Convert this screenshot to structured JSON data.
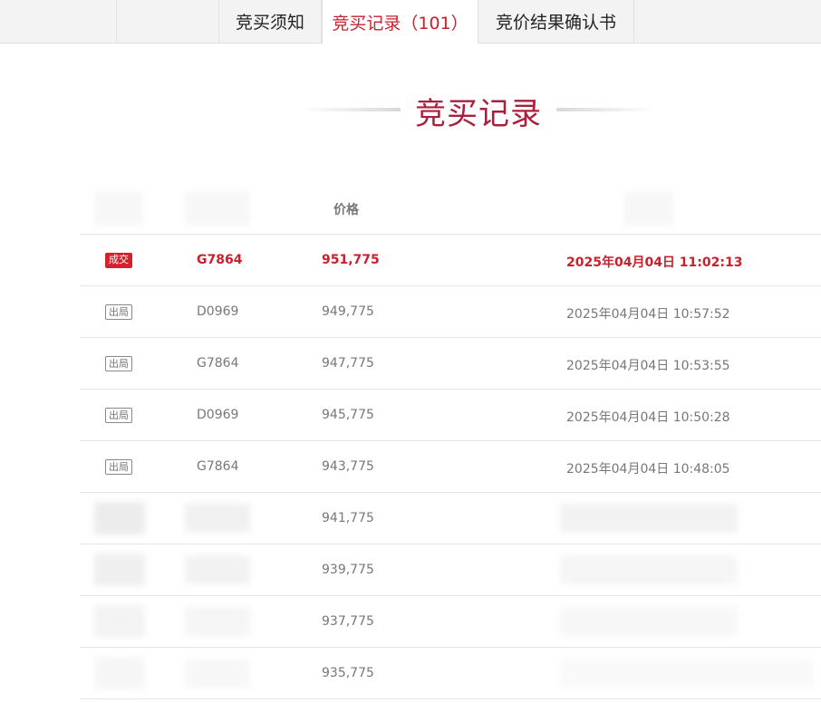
{
  "tabs": [
    {
      "label": "竞买须知",
      "active": false
    },
    {
      "label": "竞买记录（101）",
      "active": true
    },
    {
      "label": "竞价结果确认书",
      "active": false
    }
  ],
  "section_title": "竞买记录",
  "table": {
    "price_header": "价格",
    "rows": [
      {
        "status": "成交",
        "code": "G7864",
        "price": "951,775",
        "time": "2025年04月04日 11:02:13"
      },
      {
        "status": "出局",
        "code": "D0969",
        "price": "949,775",
        "time": "2025年04月04日 10:57:52"
      },
      {
        "status": "出局",
        "code": "G7864",
        "price": "947,775",
        "time": "2025年04月04日 10:53:55"
      },
      {
        "status": "出局",
        "code": "D0969",
        "price": "945,775",
        "time": "2025年04月04日 10:50:28"
      },
      {
        "status": "出局",
        "code": "G7864",
        "price": "943,775",
        "time": "2025年04月04日 10:48:05"
      },
      {
        "price": "941,775"
      },
      {
        "price": "939,775"
      },
      {
        "price": "937,775"
      },
      {
        "price": "935,775"
      }
    ]
  },
  "colors": {
    "accent": "#c8202c",
    "title": "#a8213c"
  }
}
